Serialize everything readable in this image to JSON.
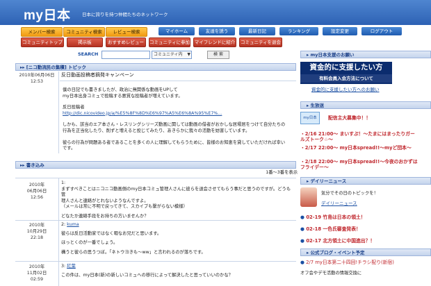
{
  "header": {
    "logo": "my日本",
    "tagline": "日本に誇りを持つ仲間たちのネットワーク"
  },
  "nav_primary": [
    {
      "label": "メンバー検索"
    },
    {
      "label": "コミュニティ検索"
    },
    {
      "label": "レビュー検索"
    },
    {
      "label": "マイホーム"
    },
    {
      "label": "友達を誘う"
    },
    {
      "label": "最新日記"
    },
    {
      "label": "ランキング"
    },
    {
      "label": "設定変更"
    },
    {
      "label": "ログアウト"
    }
  ],
  "nav_secondary": [
    {
      "label": "コミュニティトップ"
    },
    {
      "label": "掲示板"
    },
    {
      "label": "おすすめレビュー"
    },
    {
      "label": "コミュニティに参加"
    },
    {
      "label": "マイフレンドに紹介"
    },
    {
      "label": "コミュニティを退会"
    }
  ],
  "search": {
    "label": "SEARCH",
    "scope": "コミュニティ内",
    "button": "検 索"
  },
  "topic_header": "[ニコ動流民の集積] トピック",
  "topic": {
    "date": "2010年06月06日",
    "time": "12:53",
    "title": "反日動画投稿者摘発キャンペーン",
    "body1": "僕の日記でも書きましたが、政治に無関係な動画をUPして",
    "body2": "my日本出身コミュで投稿する悪質な投稿者が増えています。",
    "body3": "反日投稿者",
    "link": "http://dic.nicovideo.jp/a/%E5%8F%8D%E6%97%A5%E6%8A%95%E7%...",
    "body4": "しかも、該当のエア本さん・レスリングシリーズ動画に関しては動画の借者がおかしな居場居をつけて自分たちの",
    "body5": "行為を正当化したり、削ずと増えると投じてみたり、あきらかに我々の活動を妨害しています。",
    "body6": "彼らの行為が問題ある者であることを多くの人に理解してもらうために、皆様のお知恵を貸していただければ幸い",
    "body7": "です。"
  },
  "comments_header": "書き込み",
  "pager": "1番〜3番を表示",
  "comments": [
    {
      "date": "2010年",
      "date2": "06月06日",
      "time": "12:56",
      "num": "1:",
      "l1": "まずすべきことはニコニコ動画側のmy日本コミュ管理人さんに彼らを退会させてもらう事だと思うのですが。どうも管",
      "l2": "理人さんと連絡がとれないようなんですよ。",
      "l3": "（メールは常に不明で戻ってきて、スカイプも繋がらない模様）",
      "l4": "どなたか連絡手段をお持ちの方いませんか？"
    },
    {
      "date": "2010年",
      "date2": "10月29日",
      "time": "22:18",
      "num": "2:",
      "name": "kuma",
      "l1": "彼らは反日活動家ではなく暇なお兄だと思います。",
      "l2": "ほっとくのが一番でしょう。",
      "l3": "構うと彼らの思うつぼ。「ネトウヨきも〜ww」と言われるのが落ちです。"
    },
    {
      "date": "2010年",
      "date2": "11月02日",
      "time": "02:59",
      "num": "3:",
      "name": "紅葉",
      "l1": "この件は、my日本(新)の新しいコミュへの移行によって解決したと思っていいのかな？"
    }
  ],
  "sidebar": {
    "ad_header": "my日本支援のお願い",
    "ad_line1": "資金的に支援したい方",
    "ad_line2": "有料会員入会方法について",
    "ad_link": "資金的に支援したい方へのお願い",
    "live_header": "生放送",
    "logo_label": "my日本",
    "live_title": "配信主大募集中！！",
    "live1": "・2/16 21:00〜 まいすぷ！〜たまにはまったりガールズトーク☆〜",
    "live2": "・2/17 22:00〜 my日本spread!!〜myど団本〜",
    "live3": "・2/18 22:00〜 my日本spread!!〜今夜のおかずはフライデー〜",
    "daily_header": "デイリーニュース",
    "daily_intro": "気分でその日のトピックを！",
    "daily_link": "デイリーニュース",
    "news1": "02-19 竹島は日本の領土！",
    "news2": "02-18 一色氏審査発表！",
    "news3": "02-17 北方領土に中国進出？！",
    "event_header": "公式ブログ・イベント予定",
    "event1": "2/7 my日本第二十四回!チラシ配り(新宿)",
    "event2": "オフ会やデモ活動の情報交換に"
  },
  "colors": {
    "header_blue": "#2d61b4",
    "orange_tab": "#f19a12",
    "red_tab": "#b53223",
    "news_red": "#c0272d"
  }
}
